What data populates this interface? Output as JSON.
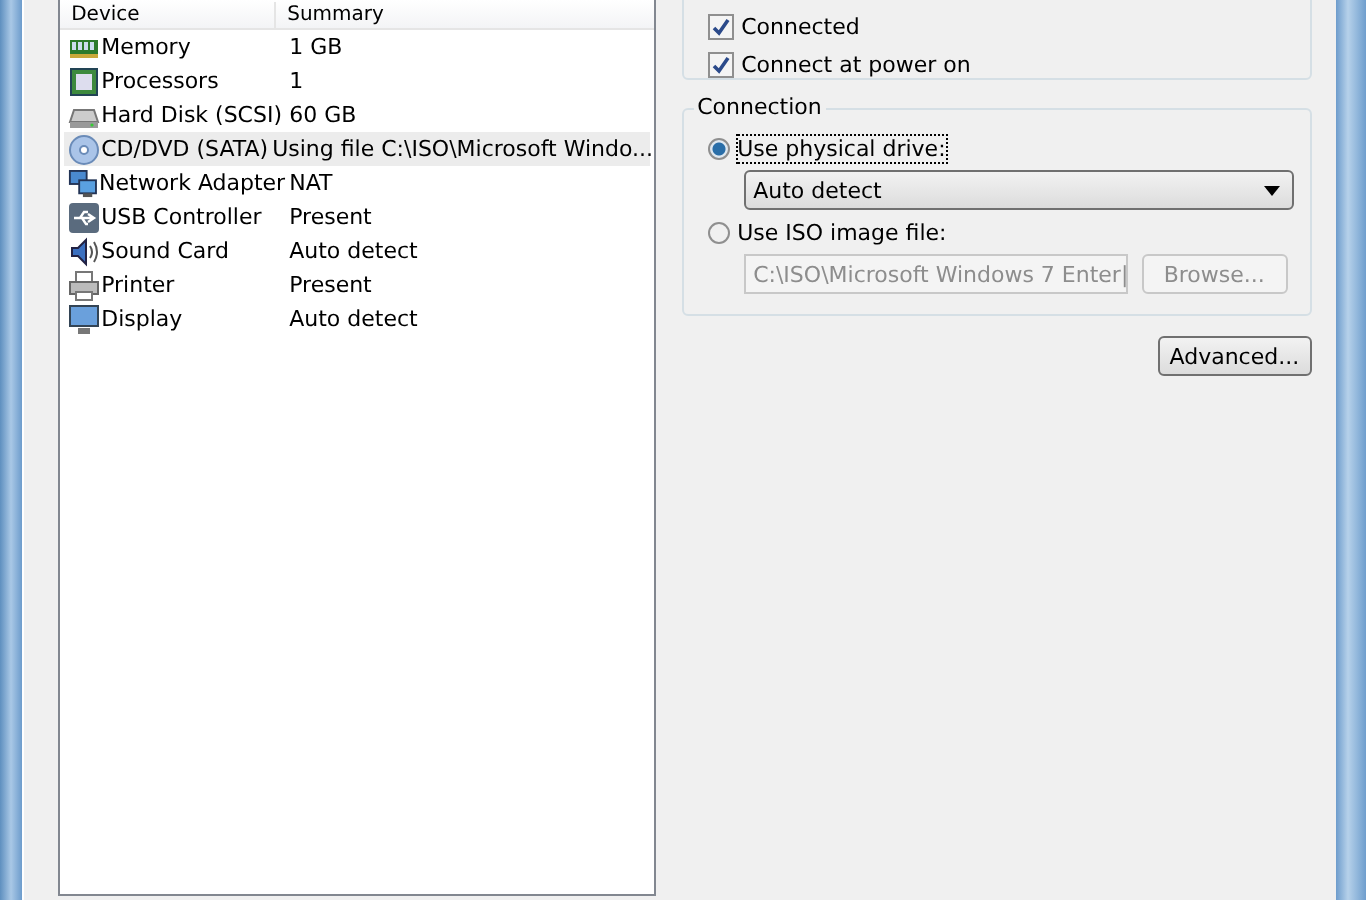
{
  "device_list": {
    "columns": [
      "Device",
      "Summary"
    ],
    "rows": [
      {
        "kind": "memory",
        "device": "Memory",
        "summary": "1 GB",
        "selected": false
      },
      {
        "kind": "processor",
        "device": "Processors",
        "summary": "1",
        "selected": false
      },
      {
        "kind": "disk",
        "device": "Hard Disk (SCSI)",
        "summary": "60 GB",
        "selected": false
      },
      {
        "kind": "cdrom",
        "device": "CD/DVD (SATA)",
        "summary": "Using file C:\\ISO\\Microsoft Windo...",
        "selected": true
      },
      {
        "kind": "network",
        "device": "Network Adapter",
        "summary": "NAT",
        "selected": false
      },
      {
        "kind": "usb",
        "device": "USB Controller",
        "summary": "Present",
        "selected": false
      },
      {
        "kind": "sound",
        "device": "Sound Card",
        "summary": "Auto detect",
        "selected": false
      },
      {
        "kind": "printer",
        "device": "Printer",
        "summary": "Present",
        "selected": false
      },
      {
        "kind": "display",
        "device": "Display",
        "summary": "Auto detect",
        "selected": false
      }
    ]
  },
  "device_status": {
    "checkboxes": [
      {
        "label": "Connected",
        "checked": true
      },
      {
        "label": "Connect at power on",
        "checked": true
      }
    ]
  },
  "connection": {
    "title": "Connection",
    "options": [
      {
        "label": "Use physical drive:",
        "selected": true,
        "focused": true,
        "control": {
          "kind": "dropdown",
          "value": "Auto detect"
        }
      },
      {
        "label": "Use ISO image file:",
        "selected": false,
        "focused": false,
        "control": {
          "kind": "combo",
          "value": "C:\\ISO\\Microsoft Windows 7 Enter|",
          "disabled": true,
          "button": "Browse..."
        }
      }
    ]
  },
  "advanced_button": "Advanced..."
}
